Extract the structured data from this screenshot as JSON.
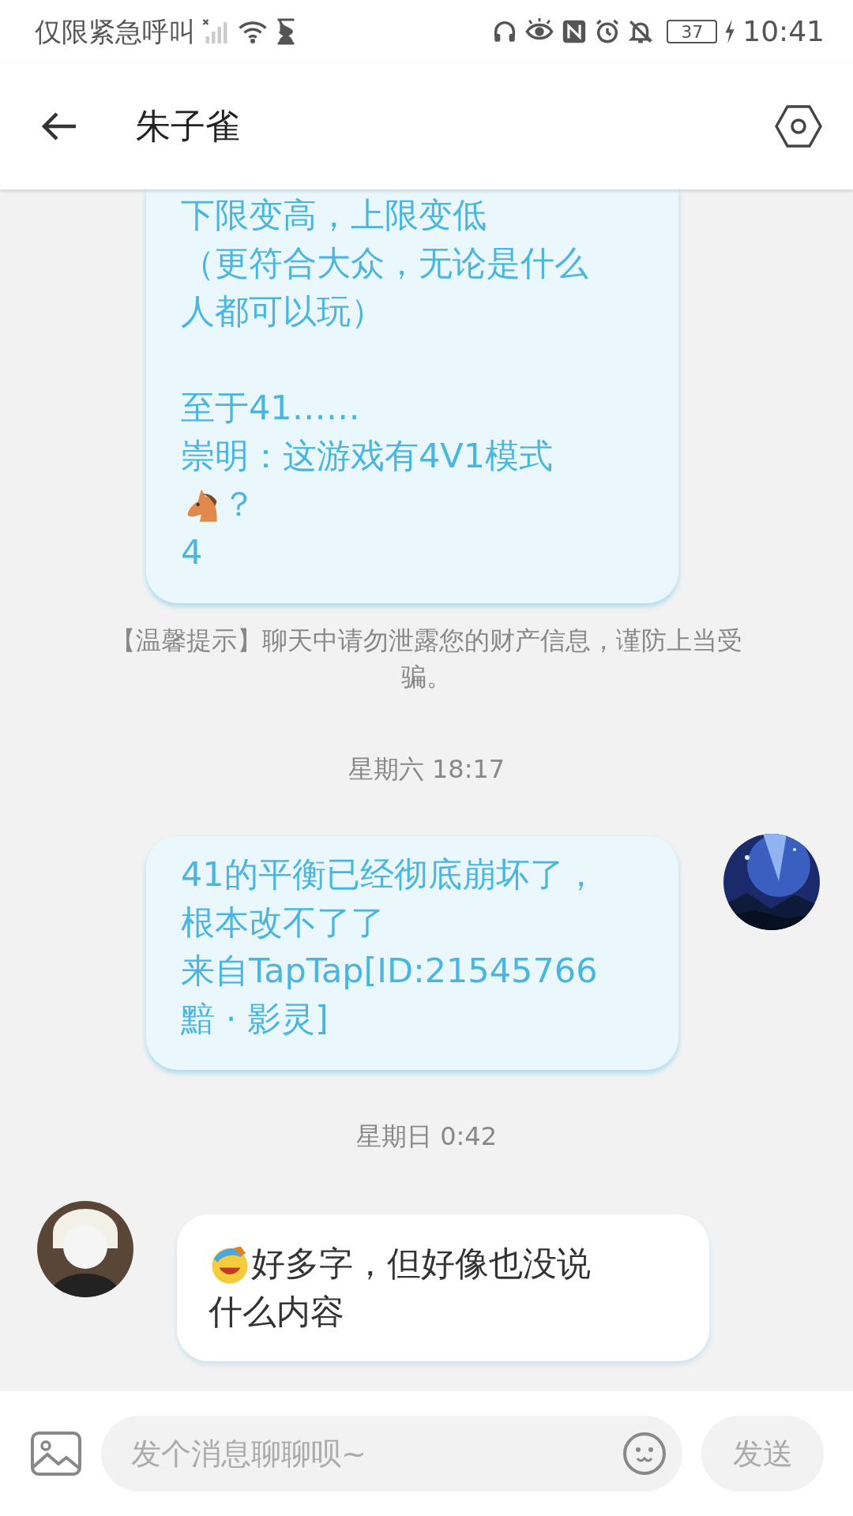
{
  "status_bar": {
    "carrier": "仅限紧急呼叫",
    "battery": "37",
    "time": "10:41"
  },
  "header": {
    "title": "朱子雀"
  },
  "messages": [
    {
      "kind": "outgoing",
      "lines": [
        {
          "text": "下限变高，上限变低"
        },
        {
          "text": "（更符合大众，无论是什么"
        },
        {
          "text": "人都可以玩）"
        },
        {
          "kind": "blank"
        },
        {
          "text": "至于41……"
        },
        {
          "text": "崇明：这游戏有4V1模式"
        },
        {
          "kind": "emoji",
          "text": "？"
        },
        {
          "text": "4"
        }
      ]
    },
    {
      "kind": "notice",
      "text": "【温馨提示】聊天中请勿泄露您的财产信息，谨防上当受骗。"
    },
    {
      "kind": "time",
      "text": "星期六 18:17"
    },
    {
      "kind": "outgoing",
      "avatar": true,
      "lines": [
        {
          "text": "41的平衡已经彻底崩坏了，"
        },
        {
          "text": "根本改不了了"
        },
        {
          "text": "来自TapTap[ID:21545766"
        },
        {
          "text": "黯 · 影灵]"
        }
      ]
    },
    {
      "kind": "time",
      "text": "星期日 0:42"
    },
    {
      "kind": "incoming",
      "avatar": true,
      "lines": [
        {
          "kind": "emoji",
          "text": "好多字，但好像也没说"
        },
        {
          "text": "什么内容"
        }
      ]
    }
  ],
  "composer": {
    "placeholder": "发个消息聊聊呗~",
    "send": "发送"
  }
}
